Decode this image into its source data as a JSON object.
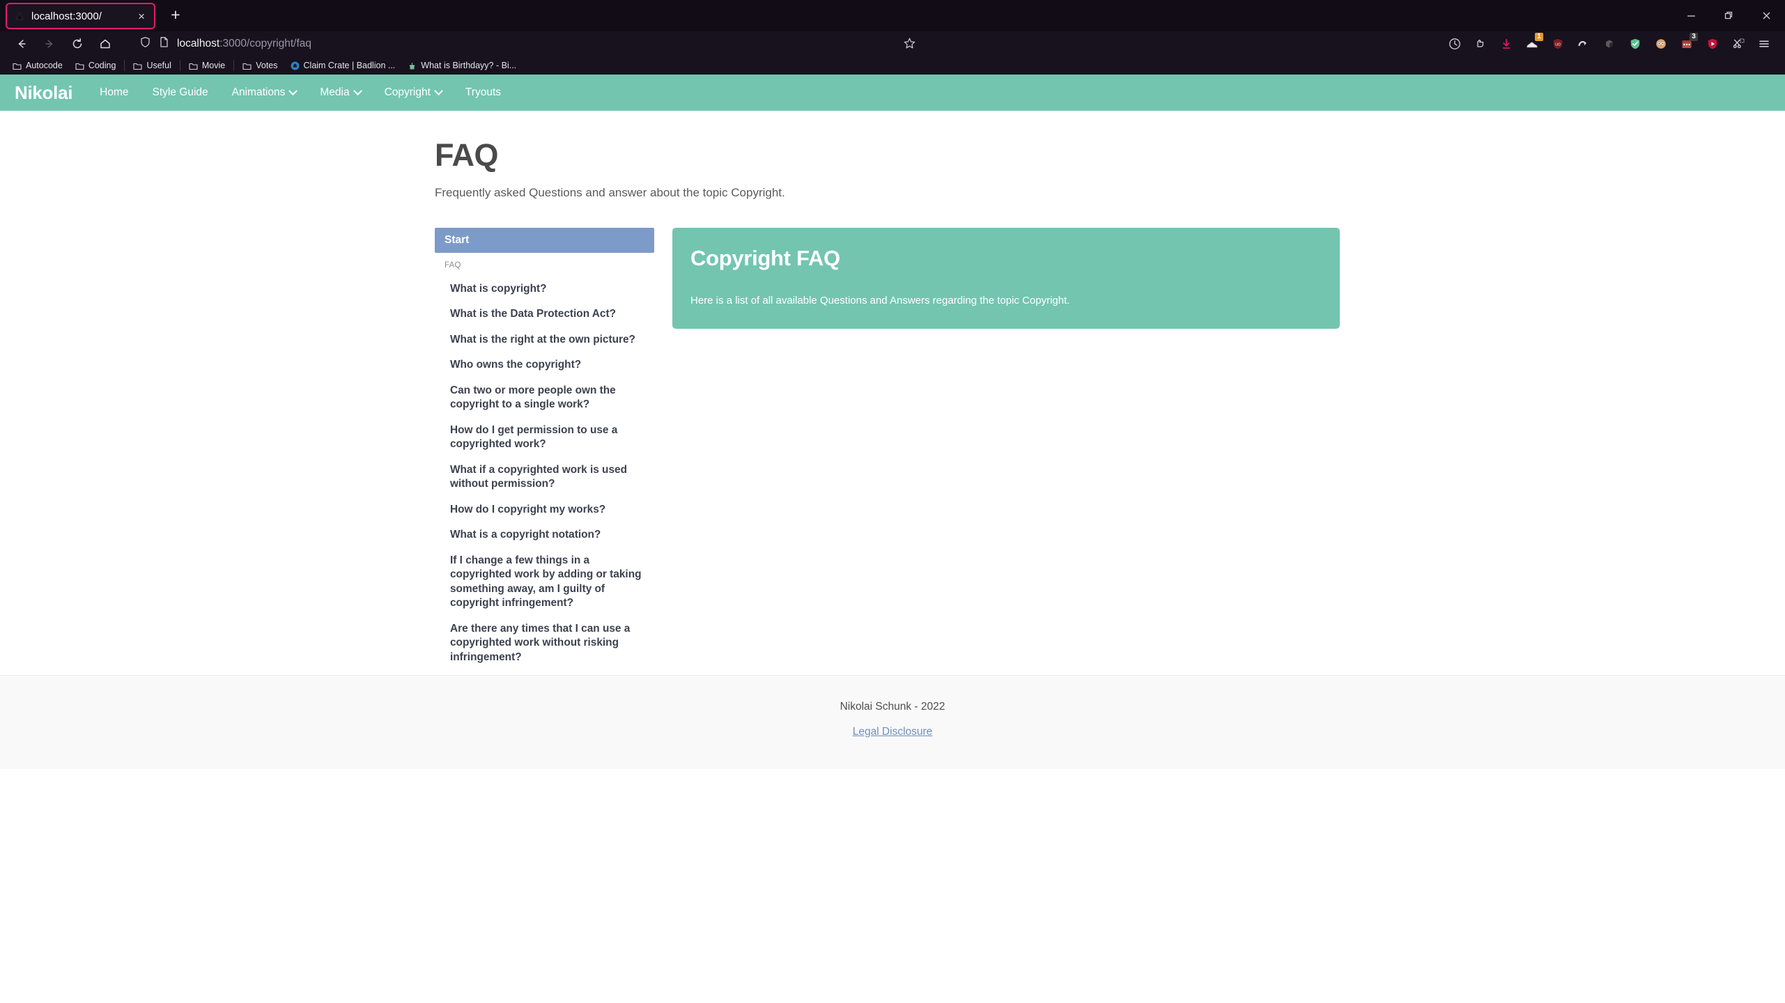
{
  "browser": {
    "tab": {
      "title": "localhost:3000/",
      "favicon": "firefox-favicon",
      "close_label": "×"
    },
    "newtab_label": "+",
    "window_controls": [
      "minimize",
      "restore",
      "close"
    ],
    "nav_buttons": [
      "back-arrow",
      "forward-arrow",
      "reload",
      "home"
    ],
    "url": {
      "host": "localhost",
      "path": ":3000/copyright/faq",
      "shield_icon": "shield-icon",
      "page_icon": "page-icon",
      "bookmark_icon": "star-icon"
    },
    "toolbar_icons": [
      {
        "name": "history-icon",
        "badge": ""
      },
      {
        "name": "pocket-icon",
        "badge": ""
      },
      {
        "name": "downloads-icon",
        "badge": ""
      },
      {
        "name": "extension-sneaker-icon",
        "badge": "1"
      },
      {
        "name": "ublock-origin-icon",
        "badge": ""
      },
      {
        "name": "redirect-icon",
        "badge": ""
      },
      {
        "name": "dark-reader-icon",
        "badge": ""
      },
      {
        "name": "shield-green-icon",
        "badge": ""
      },
      {
        "name": "avatar-extension-icon",
        "badge": ""
      },
      {
        "name": "calendar-extension-icon",
        "badge": "3"
      },
      {
        "name": "video-download-icon",
        "badge": ""
      },
      {
        "name": "screenshot-scissors-icon",
        "badge": ""
      },
      {
        "name": "hamburger-menu-icon",
        "badge": ""
      }
    ],
    "bookmarks": [
      {
        "label": "Autocode",
        "icon": "folder-icon"
      },
      {
        "label": "Coding",
        "icon": "folder-icon"
      },
      {
        "label": "Useful",
        "icon": "folder-icon"
      },
      {
        "label": "Movie",
        "icon": "folder-icon"
      },
      {
        "label": "Votes",
        "icon": "folder-icon"
      },
      {
        "label": "Claim Crate | Badlion ...",
        "icon": "badlion-icon"
      },
      {
        "label": "What is Birthdayy? - Bi...",
        "icon": "birthdayy-icon"
      }
    ]
  },
  "site": {
    "brand": "Nikolai",
    "nav": [
      {
        "label": "Home",
        "dropdown": false
      },
      {
        "label": "Style Guide",
        "dropdown": false
      },
      {
        "label": "Animations",
        "dropdown": true
      },
      {
        "label": "Media",
        "dropdown": true
      },
      {
        "label": "Copyright",
        "dropdown": true
      },
      {
        "label": "Tryouts",
        "dropdown": false
      }
    ],
    "page": {
      "title": "FAQ",
      "subtitle": "Frequently asked Questions and answer about the topic Copyright."
    },
    "sidebar": {
      "start_label": "Start",
      "caption": "FAQ",
      "items": [
        {
          "label": "What is copyright?"
        },
        {
          "label": "What is the Data Protection Act?"
        },
        {
          "label": "What is the right at the own picture?"
        },
        {
          "label": "Who owns the copyright?"
        },
        {
          "label": "Can two or more people own the copyright to a single work?"
        },
        {
          "label": "How do I get permission to use a copyrighted work?"
        },
        {
          "label": "What if a copyrighted work is used without permission?"
        },
        {
          "label": "How do I copyright my works?"
        },
        {
          "label": "What is a copyright notation?"
        },
        {
          "label": "If I change a few things in a copyrighted work by adding or taking something away, am I guilty of copyright infringement?"
        },
        {
          "label": "Are there any times that I can use a copyrighted work without risking infringement?"
        }
      ]
    },
    "card": {
      "title": "Copyright FAQ",
      "text": "Here is a list of all available Questions and Answers regarding the topic Copyright."
    },
    "footer": {
      "copyright": "Nikolai Schunk - 2022",
      "link": "Legal Disclosure"
    },
    "colors": {
      "teal": "#73c5b0",
      "start_blue": "#7d9bc8",
      "link_blue": "#6f8fbf",
      "heading_gray": "#4a4a4a",
      "tab_accent": "#e31c6d"
    }
  }
}
